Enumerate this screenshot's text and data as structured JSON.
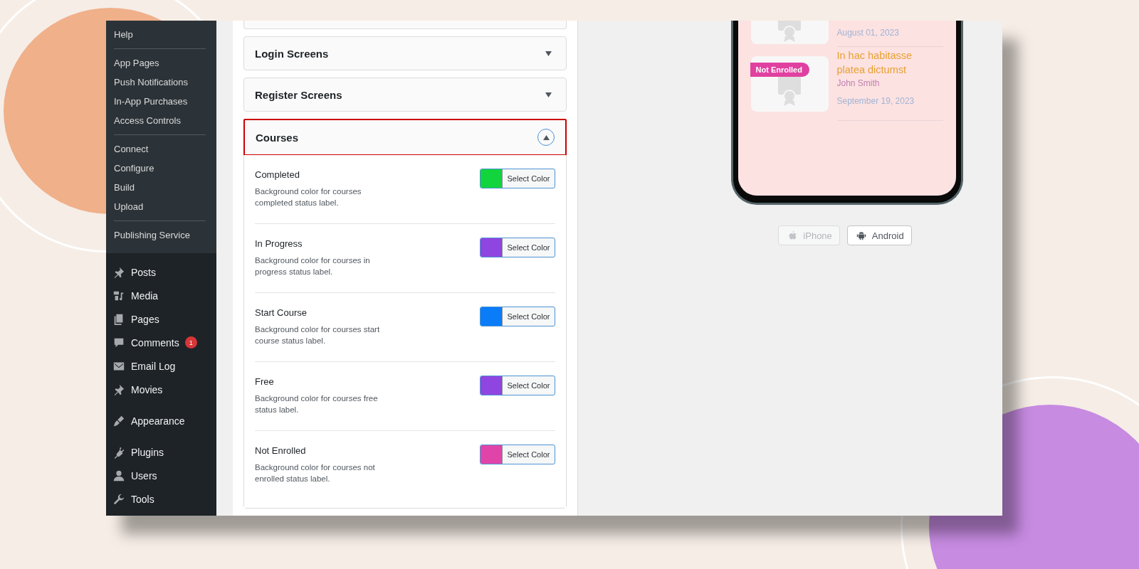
{
  "sidebar": {
    "groups": [
      {
        "items": [
          {
            "label": "Help"
          }
        ]
      },
      {
        "items": [
          {
            "label": "App Pages"
          },
          {
            "label": "Push Notifications"
          },
          {
            "label": "In-App Purchases"
          },
          {
            "label": "Access Controls"
          }
        ]
      },
      {
        "items": [
          {
            "label": "Connect"
          },
          {
            "label": "Configure"
          },
          {
            "label": "Build"
          },
          {
            "label": "Upload"
          }
        ]
      },
      {
        "items": [
          {
            "label": "Publishing Service"
          }
        ]
      }
    ],
    "menu": [
      {
        "label": "Posts"
      },
      {
        "label": "Media"
      },
      {
        "label": "Pages"
      },
      {
        "label": "Comments",
        "badge": "1"
      },
      {
        "label": "Email Log"
      },
      {
        "label": "Movies"
      },
      {
        "label": "Appearance"
      },
      {
        "label": "Plugins"
      },
      {
        "label": "Users"
      },
      {
        "label": "Tools"
      }
    ]
  },
  "accordions": [
    {
      "title": "Login Screens",
      "expanded": false,
      "highlighted": false
    },
    {
      "title": "Register Screens",
      "expanded": false,
      "highlighted": false
    },
    {
      "title": "Courses",
      "expanded": true,
      "highlighted": true,
      "settings": [
        {
          "label": "Completed",
          "description": "Background color for courses completed status label.",
          "color": "#12d43c",
          "button": "Select Color"
        },
        {
          "label": "In Progress",
          "description": "Background color for courses in progress status label.",
          "color": "#8f45e0",
          "button": "Select Color"
        },
        {
          "label": "Start Course",
          "description": "Background color for courses start course status label.",
          "color": "#0a7cf7",
          "button": "Select Color"
        },
        {
          "label": "Free",
          "description": "Background color for courses free status label.",
          "color": "#8f45e0",
          "button": "Select Color"
        },
        {
          "label": "Not Enrolled",
          "description": "Background color for courses not enrolled status label.",
          "color": "#e044a8",
          "button": "Select Color"
        }
      ]
    }
  ],
  "preview": {
    "courses": [
      {
        "date": "August 01, 2023"
      },
      {
        "badge": "Not Enrolled",
        "title": "In hac habitasse platea dictumst",
        "author": "John Smith",
        "date": "September 19, 2023"
      }
    ],
    "platforms": [
      {
        "label": "iPhone",
        "selected": false
      },
      {
        "label": "Android",
        "selected": true
      }
    ]
  }
}
